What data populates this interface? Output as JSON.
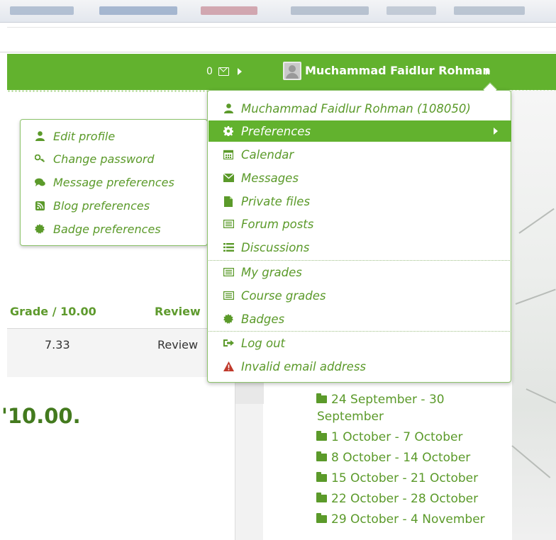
{
  "navbar": {
    "message_count": "0",
    "user_name": "Muchammad Faidlur Rohman"
  },
  "user_menu": {
    "items": [
      {
        "label": "Muchammad Faidlur Rohman (108050)",
        "icon": "user-icon"
      },
      {
        "label": "Preferences",
        "icon": "gear-icon",
        "active": true
      },
      {
        "label": "Calendar",
        "icon": "calendar-icon"
      },
      {
        "label": "Messages",
        "icon": "envelope-icon"
      },
      {
        "label": "Private files",
        "icon": "file-icon"
      },
      {
        "label": "Forum posts",
        "icon": "list-icon"
      },
      {
        "label": "Discussions",
        "icon": "list-icon"
      },
      {
        "label": "My grades",
        "icon": "table-icon"
      },
      {
        "label": "Course grades",
        "icon": "table-icon"
      },
      {
        "label": "Badges",
        "icon": "badge-icon"
      },
      {
        "label": "Log out",
        "icon": "logout-icon"
      },
      {
        "label": "Invalid email address",
        "icon": "warning-icon"
      }
    ]
  },
  "preferences_submenu": {
    "items": [
      {
        "label": "Edit profile",
        "icon": "user-icon"
      },
      {
        "label": "Change password",
        "icon": "key-icon"
      },
      {
        "label": "Message preferences",
        "icon": "chat-icon"
      },
      {
        "label": "Blog preferences",
        "icon": "rss-icon"
      },
      {
        "label": "Badge preferences",
        "icon": "badge-icon"
      }
    ]
  },
  "grades_table": {
    "headers": [
      "Grade / 10.00",
      "Review"
    ],
    "rows": [
      [
        "7.33",
        "Review"
      ]
    ]
  },
  "grade_summary": "'10.00.",
  "weeks": [
    "24 September - 30",
    "September",
    "1 October - 7 October",
    "8 October - 14 October",
    "15 October - 21 October",
    "22 October - 28 October",
    "29 October - 4 November"
  ],
  "colors": {
    "brand_green": "#62b22e",
    "link_green": "#5b9a2a",
    "warning_red": "#c0392b"
  }
}
